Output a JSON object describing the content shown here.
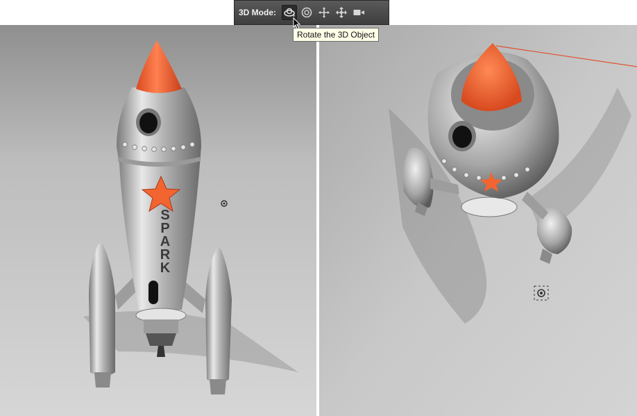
{
  "toolbar": {
    "label": "3D Mode:",
    "tools": [
      {
        "icon": "rotate-3d-icon",
        "active": true
      },
      {
        "icon": "roll-3d-icon",
        "active": false
      },
      {
        "icon": "pan-3d-icon",
        "active": false
      },
      {
        "icon": "slide-3d-icon",
        "active": false
      },
      {
        "icon": "scale-3d-camera-icon",
        "active": false
      }
    ]
  },
  "tooltip": {
    "text": "Rotate the 3D Object"
  },
  "left_viewport": {
    "rocket_text": "SPARK",
    "ground_light": "#dadada",
    "ground_dark": "#b8b8b8"
  },
  "right_viewport": {
    "axis_color": "#e0522f"
  },
  "colors": {
    "accent_orange": "#f26430",
    "toolbar_bg": "#4a4a4a",
    "metal": "#b8b8b8"
  }
}
